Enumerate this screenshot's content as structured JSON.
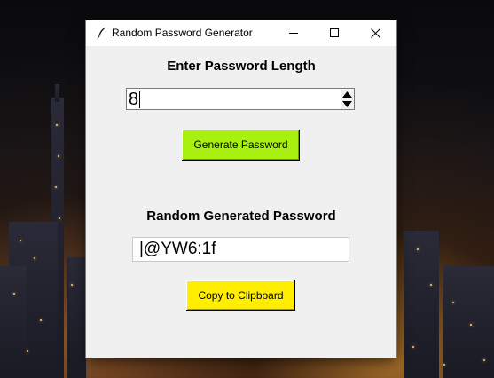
{
  "window": {
    "title": "Random Password Generator",
    "controls": {
      "minimize_icon": "minimize-icon",
      "maximize_icon": "maximize-icon",
      "close_icon": "close-icon"
    }
  },
  "length_section": {
    "heading": "Enter Password Length",
    "value": "8"
  },
  "generate_button": {
    "label": "Generate Password",
    "color": "#a8f010"
  },
  "result_section": {
    "heading": "Random Generated Password",
    "password": "|@YW6:1f"
  },
  "copy_button": {
    "label": "Copy to Clipboard",
    "color": "#ffee00"
  },
  "desktop": {
    "wallpaper": "night city skyline"
  }
}
